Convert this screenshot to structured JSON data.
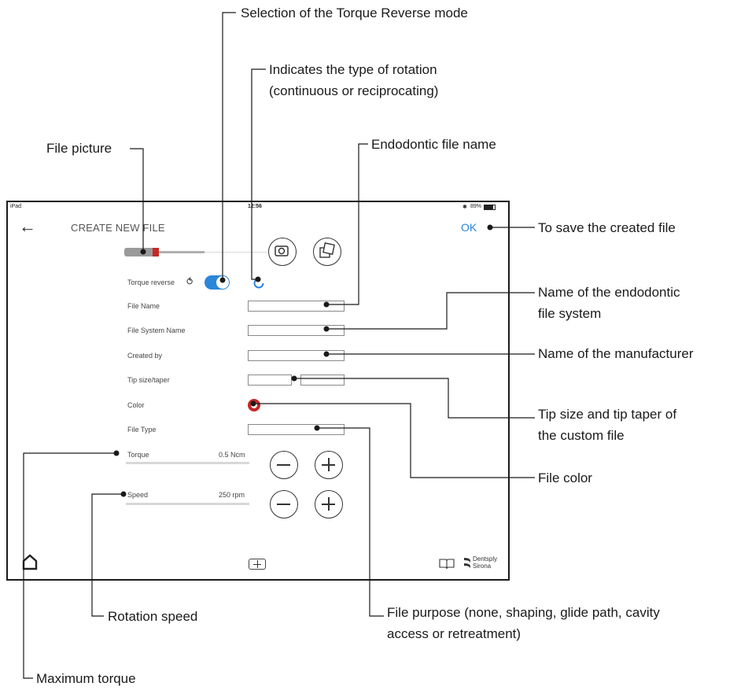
{
  "callouts": {
    "torque_reverse_mode": "Selection of the Torque Reverse mode",
    "rotation_type_1": "Indicates the type of rotation",
    "rotation_type_2": "(continuous or reciprocating)",
    "file_picture": "File picture",
    "endo_file_name": "Endodontic file name",
    "save": "To save the created file",
    "file_system_1": "Name of the endodontic",
    "file_system_2": "file system",
    "manufacturer": "Name of the manufacturer",
    "tip_1": "Tip size and tip taper of",
    "tip_2": "the custom file",
    "file_color": "File color",
    "rotation_speed": "Rotation speed",
    "file_purpose_1": "File purpose (none, shaping, glide path, cavity",
    "file_purpose_2": "access or retreatment)",
    "max_torque": "Maximum torque"
  },
  "status_bar": {
    "device": "iPad",
    "time": "12:56",
    "battery": "89%"
  },
  "header": {
    "title": "CREATE NEW FILE",
    "ok_label": "OK"
  },
  "form": {
    "torque_reverse_label": "Torque reverse",
    "torque_reverse_on": true,
    "file_name_label": "File Name",
    "file_system_label": "File System Name",
    "created_by_label": "Created by",
    "tip_label": "Tip size/taper",
    "color_label": "Color",
    "color_value": "#c62828",
    "file_type_label": "File Type"
  },
  "settings": {
    "torque_label": "Torque",
    "torque_value": "0.5 Ncm",
    "speed_label": "Speed",
    "speed_value": "250 rpm"
  },
  "footer": {
    "brand_1": "Dentsply",
    "brand_2": "Sirona"
  },
  "colors": {
    "accent": "#2a86d9",
    "file_red": "#c62828"
  }
}
